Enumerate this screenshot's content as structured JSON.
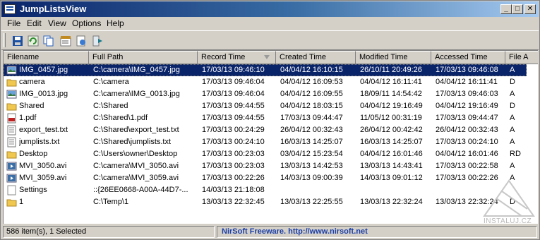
{
  "window": {
    "title": "JumpListsView"
  },
  "menu": [
    "File",
    "Edit",
    "View",
    "Options",
    "Help"
  ],
  "toolbar": [
    {
      "name": "save-icon",
      "color": "#1c4fa0"
    },
    {
      "name": "refresh-icon",
      "color": "#2e8b2e"
    },
    {
      "name": "copy-icon",
      "color": "#2a5fb8"
    },
    {
      "name": "properties-icon",
      "color": "#c08a20"
    },
    {
      "name": "html-report-icon",
      "color": "#3a7ad0"
    },
    {
      "name": "exit-icon",
      "color": "#1a7a8a"
    }
  ],
  "columns": [
    "Filename",
    "Full Path",
    "Record Time",
    "Created Time",
    "Modified Time",
    "Accessed Time",
    "File A"
  ],
  "sorted_column": "Record Time",
  "rows": [
    {
      "icon": "image",
      "cells": [
        "IMG_0457.jpg",
        "C:\\camera\\IMG_0457.jpg",
        "17/03/13 09:46:10",
        "04/04/12 16:10:15",
        "26/10/11 20:49:26",
        "17/03/13 09:46:08",
        "A"
      ],
      "selected": true
    },
    {
      "icon": "folder",
      "cells": [
        "camera",
        "C:\\camera",
        "17/03/13 09:46:04",
        "04/04/12 16:09:53",
        "04/04/12 16:11:41",
        "04/04/12 16:11:41",
        "D"
      ]
    },
    {
      "icon": "image",
      "cells": [
        "IMG_0013.jpg",
        "C:\\camera\\IMG_0013.jpg",
        "17/03/13 09:46:04",
        "04/04/12 16:09:55",
        "18/09/11 14:54:42",
        "17/03/13 09:46:03",
        "A"
      ]
    },
    {
      "icon": "folder",
      "cells": [
        "Shared",
        "C:\\Shared",
        "17/03/13 09:44:55",
        "04/04/12 18:03:15",
        "04/04/12 19:16:49",
        "04/04/12 19:16:49",
        "D"
      ]
    },
    {
      "icon": "pdf",
      "cells": [
        "1.pdf",
        "C:\\Shared\\1.pdf",
        "17/03/13 09:44:55",
        "17/03/13 09:44:47",
        "11/05/12 00:31:19",
        "17/03/13 09:44:47",
        "A"
      ]
    },
    {
      "icon": "text",
      "cells": [
        "export_test.txt",
        "C:\\Shared\\export_test.txt",
        "17/03/13 00:24:29",
        "26/04/12 00:32:43",
        "26/04/12 00:42:42",
        "26/04/12 00:32:43",
        "A"
      ]
    },
    {
      "icon": "text",
      "cells": [
        "jumplists.txt",
        "C:\\Shared\\jumplists.txt",
        "17/03/13 00:24:10",
        "16/03/13 14:25:07",
        "16/03/13 14:25:07",
        "17/03/13 00:24:10",
        "A"
      ]
    },
    {
      "icon": "folder",
      "cells": [
        "Desktop",
        "C:\\Users\\owner\\Desktop",
        "17/03/13 00:23:03",
        "03/04/12 15:23:54",
        "04/04/12 16:01:46",
        "04/04/12 16:01:46",
        "RD"
      ]
    },
    {
      "icon": "video",
      "cells": [
        "MVI_3050.avi",
        "C:\\camera\\MVI_3050.avi",
        "17/03/13 00:23:03",
        "13/03/13 14:42:53",
        "13/03/13 14:43:41",
        "17/03/13 00:22:58",
        "A"
      ]
    },
    {
      "icon": "video",
      "cells": [
        "MVI_3059.avi",
        "C:\\camera\\MVI_3059.avi",
        "17/03/13 00:22:26",
        "14/03/13 09:00:39",
        "14/03/13 09:01:12",
        "17/03/13 00:22:26",
        "A"
      ]
    },
    {
      "icon": "settings",
      "cells": [
        "Settings",
        "::{26EE0668-A00A-44D7-...",
        "14/03/13 21:18:08",
        "",
        "",
        "",
        ""
      ]
    },
    {
      "icon": "folder",
      "cells": [
        "1",
        "C:\\Temp\\1",
        "13/03/13 22:32:45",
        "13/03/13 22:25:55",
        "13/03/13 22:32:24",
        "13/03/13 22:32:24",
        "D"
      ]
    }
  ],
  "status": {
    "count": "586 item(s), 1 Selected",
    "credit": "NirSoft Freeware.  http://www.nirsoft.net"
  },
  "watermark": "INSTALUJ.CZ"
}
